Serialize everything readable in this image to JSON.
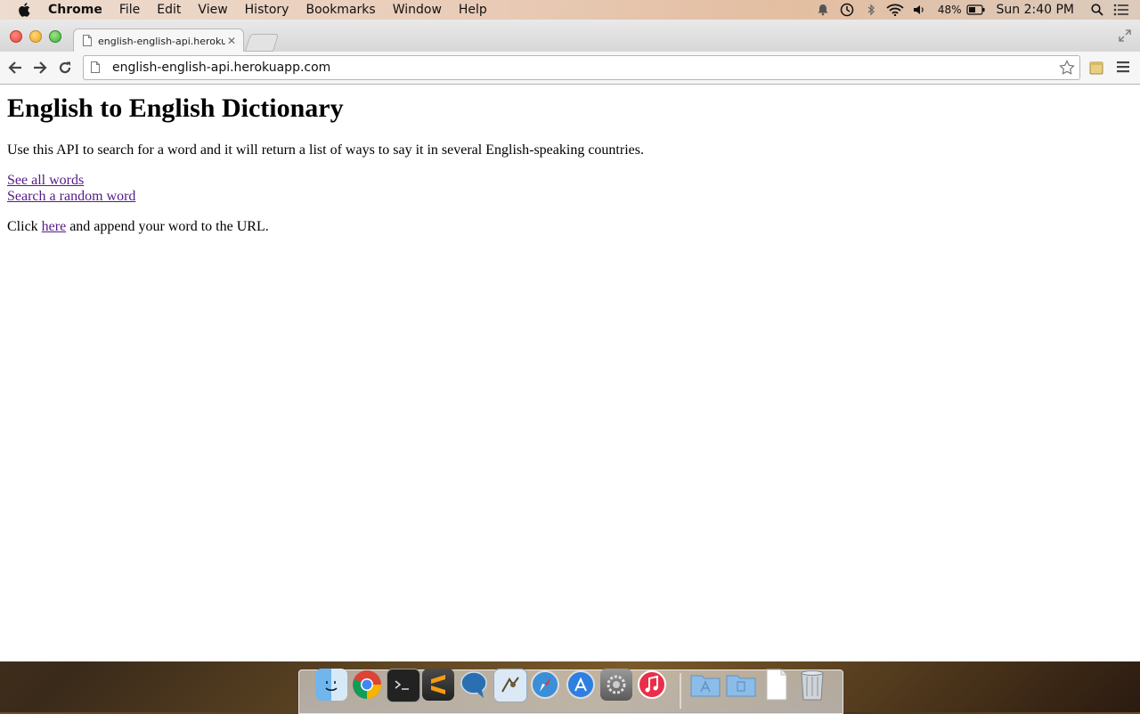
{
  "menubar": {
    "app_name": "Chrome",
    "items": [
      "File",
      "Edit",
      "View",
      "History",
      "Bookmarks",
      "Window",
      "Help"
    ],
    "battery": "48%",
    "clock": "Sun 2:40 PM"
  },
  "browser": {
    "tab_title": "english-english-api.herokuapp.com",
    "url": "english-english-api.herokuapp.com"
  },
  "page": {
    "heading": "English to English Dictionary",
    "intro": "Use this API to search for a word and it will return a list of ways to say it in several English-speaking countries.",
    "link_all_words": "See all words",
    "link_random_word": "Search a random word",
    "click_prefix": "Click ",
    "click_link": "here",
    "click_suffix": " and append your word to the URL."
  },
  "dock": {
    "icons": [
      "finder-icon",
      "chrome-icon",
      "terminal-icon",
      "sublime-text-icon",
      "chat-icon",
      "mail-icon",
      "safari-icon",
      "app-store-icon",
      "system-preferences-icon",
      "itunes-icon",
      "applications-folder-icon",
      "documents-folder-icon",
      "document-icon",
      "trash-icon"
    ]
  }
}
